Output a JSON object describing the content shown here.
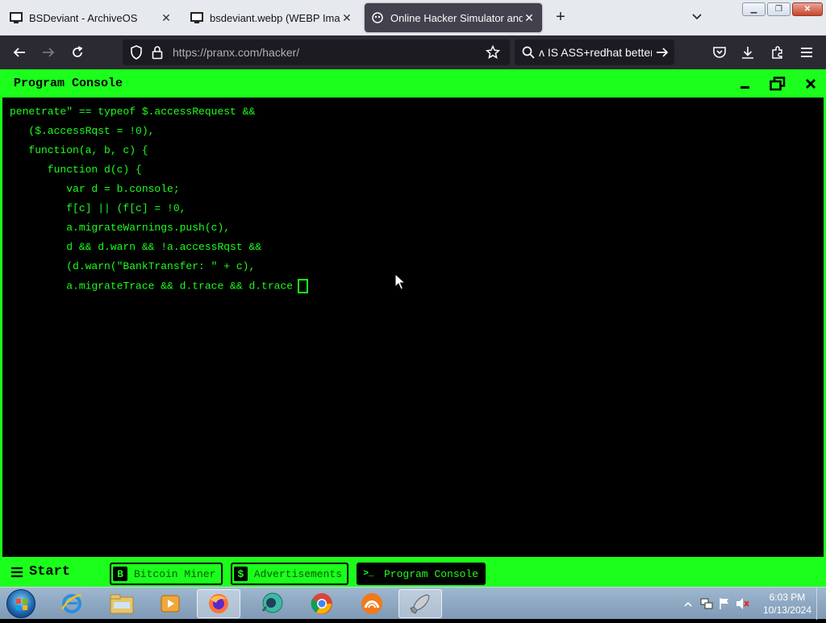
{
  "browser": {
    "tabs": [
      {
        "label": "BSDeviant - ArchiveOS",
        "icon": "terminal-icon"
      },
      {
        "label": "bsdeviant.webp (WEBP Image,",
        "icon": "terminal-icon"
      },
      {
        "label": "Online Hacker Simulator and Ty",
        "icon": "pranx-icon"
      }
    ],
    "url": "https://pranx.com/hacker/",
    "search_text": "ʌ IS ASS+redhat better"
  },
  "console": {
    "title": "Program Console",
    "lines": [
      "penetrate\" == typeof $.accessRequest &&",
      "   ($.accessRqst = !0),",
      "   function(a, b, c) {",
      "      function d(c) {",
      "         var d = b.console;",
      "         f[c] || (f[c] = !0,",
      "         a.migrateWarnings.push(c),",
      "         d && d.warn && !a.accessRqst &&",
      "         (d.warn(\"BankTransfer: \" + c),",
      "         a.migrateTrace && d.trace && d.trace"
    ]
  },
  "page_taskbar": {
    "start_label": "Start",
    "buttons": [
      {
        "icon_text": "B",
        "label": "Bitcoin Miner"
      },
      {
        "icon_text": "$",
        "label": "Advertisements"
      },
      {
        "icon_text": ">_",
        "label": "Program Console"
      }
    ]
  },
  "system": {
    "time": "6:03 PM",
    "date": "10/13/2024"
  },
  "colors": {
    "terminal_green": "#1cff1c",
    "browser_dark": "#2b2a33"
  }
}
